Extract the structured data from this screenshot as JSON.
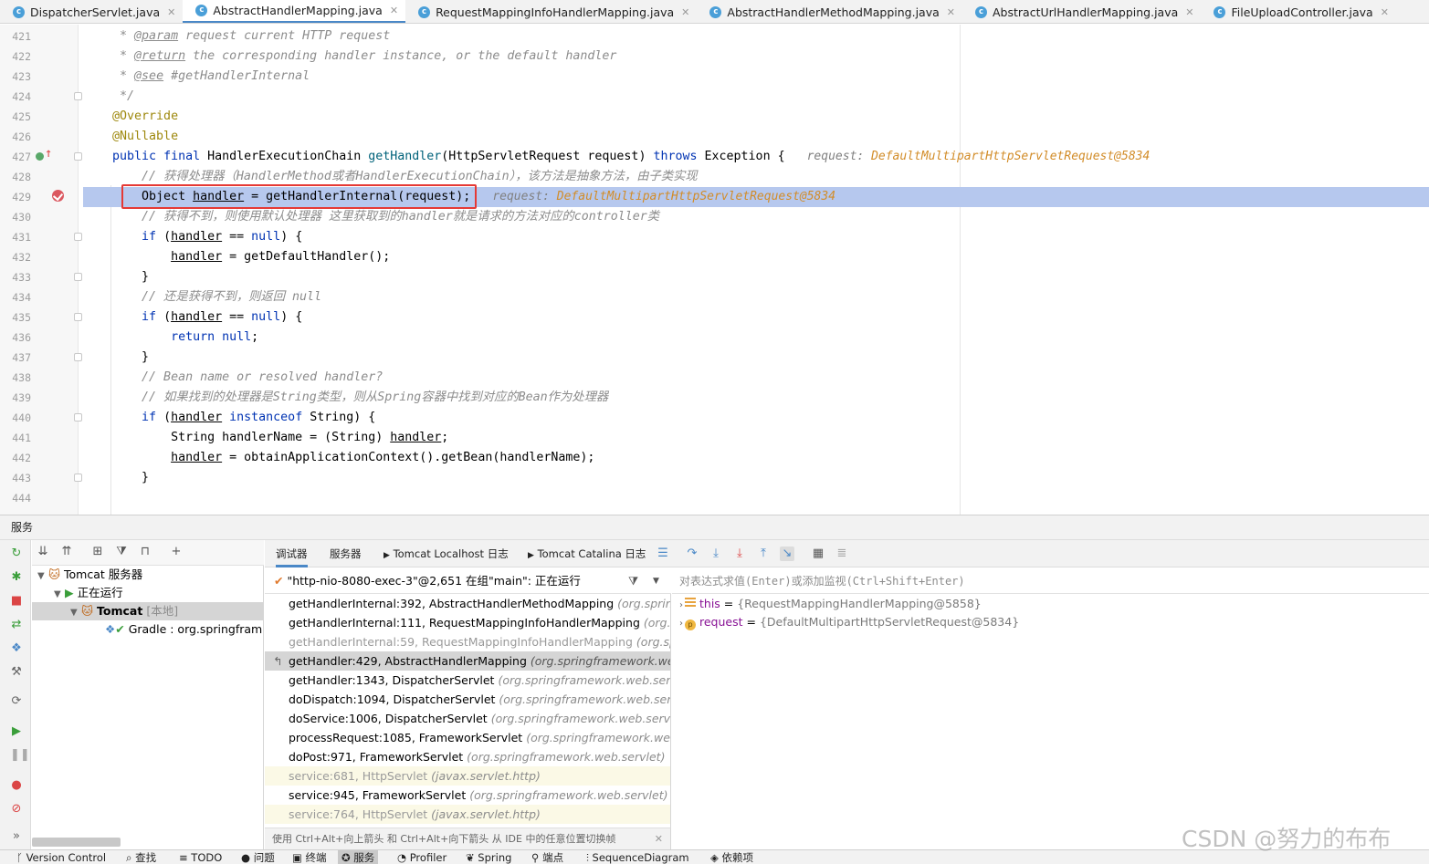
{
  "tabs": [
    {
      "label": "DispatcherServlet.java",
      "active": false
    },
    {
      "label": "AbstractHandlerMapping.java",
      "active": true
    },
    {
      "label": "RequestMappingInfoHandlerMapping.java",
      "active": false
    },
    {
      "label": "AbstractHandlerMethodMapping.java",
      "active": false
    },
    {
      "label": "AbstractUrlHandlerMapping.java",
      "active": false
    },
    {
      "label": "FileUploadController.java",
      "active": false
    }
  ],
  "editor": {
    "line_numbers": [
      "421",
      "422",
      "423",
      "424",
      "425",
      "426",
      "427",
      "428",
      "429",
      "430",
      "431",
      "432",
      "433",
      "434",
      "435",
      "436",
      "437",
      "438",
      "439",
      "440",
      "441",
      "442",
      "443",
      "444"
    ],
    "inlay_hint_key": "request: ",
    "inlay_hint_value": "DefaultMultipartHttpServletRequest@5834"
  },
  "services": {
    "panel_title": "服务",
    "tree": {
      "root": "Tomcat 服务器",
      "running": "正在运行",
      "server_name": "Tomcat",
      "server_tag": "[本地]",
      "artifact": "Gradle : org.springframe"
    }
  },
  "debugger": {
    "tabs": [
      "调试器",
      "服务器",
      "Tomcat Localhost 日志",
      "Tomcat Catalina 日志"
    ],
    "thread": "\"http-nio-8080-exec-3\"@2,651 在组\"main\": 正在运行",
    "frames": [
      {
        "method": "getHandlerInternal:392, AbstractHandlerMethodMapping",
        "pkg": "(org.springfra",
        "style": "normal"
      },
      {
        "method": "getHandlerInternal:111, RequestMappingInfoHandlerMapping",
        "pkg": "(org.spri",
        "style": "normal"
      },
      {
        "method": "getHandlerInternal:59, RequestMappingInfoHandlerMapping",
        "pkg": "(org.spring",
        "style": "dim"
      },
      {
        "method": "getHandler:429, AbstractHandlerMapping",
        "pkg": "(org.springframework.web.se",
        "style": "current"
      },
      {
        "method": "getHandler:1343, DispatcherServlet",
        "pkg": "(org.springframework.web.servlet)",
        "style": "normal"
      },
      {
        "method": "doDispatch:1094, DispatcherServlet",
        "pkg": "(org.springframework.web.servlet)",
        "style": "normal"
      },
      {
        "method": "doService:1006, DispatcherServlet",
        "pkg": "(org.springframework.web.servlet)",
        "style": "normal"
      },
      {
        "method": "processRequest:1085, FrameworkServlet",
        "pkg": "(org.springframework.web.serv",
        "style": "normal"
      },
      {
        "method": "doPost:971, FrameworkServlet",
        "pkg": "(org.springframework.web.servlet)",
        "style": "normal"
      },
      {
        "method": "service:681, HttpServlet",
        "pkg": "(javax.servlet.http)",
        "style": "lib"
      },
      {
        "method": "service:945, FrameworkServlet",
        "pkg": "(org.springframework.web.servlet)",
        "style": "normal"
      },
      {
        "method": "service:764, HttpServlet",
        "pkg": "(javax.servlet.http)",
        "style": "lib"
      }
    ],
    "hint": "使用 Ctrl+Alt+向上箭头 和 Ctrl+Alt+向下箭头 从 IDE 中的任意位置切换帧",
    "eval_placeholder": "对表达式求值(Enter)或添加监视(Ctrl+Shift+Enter)",
    "variables": [
      {
        "name": "this",
        "eq": " = ",
        "value": "{RequestMappingHandlerMapping@5858}"
      },
      {
        "name": "request",
        "eq": " = ",
        "value": "{DefaultMultipartHttpServletRequest@5834}"
      }
    ]
  },
  "statusbar": [
    "Version Control",
    "查找",
    "TODO",
    "问题",
    "终端",
    "服务",
    "Profiler",
    "Spring",
    "端点",
    "SequenceDiagram",
    "依赖项"
  ],
  "watermark": "CSDN @努力的布布"
}
